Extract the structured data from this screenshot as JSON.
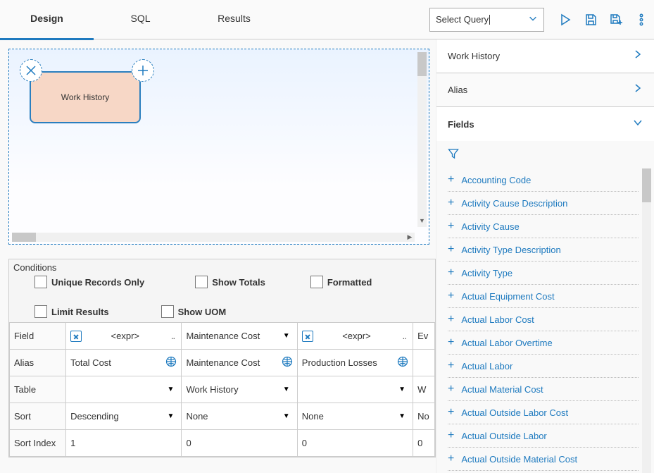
{
  "tabs": [
    "Design",
    "SQL",
    "Results"
  ],
  "activeTab": 0,
  "selectQuery": "Select Query",
  "canvasNode": {
    "label": "Work History"
  },
  "conditions": {
    "title": "Conditions",
    "unique": "Unique Records Only",
    "showTotals": "Show Totals",
    "formatted": "Formatted",
    "limitResults": "Limit Results",
    "showUom": "Show UOM"
  },
  "grid": {
    "rows": [
      "Field",
      "Alias",
      "Table",
      "Sort",
      "Sort Index"
    ],
    "cols": [
      {
        "field": "<expr>",
        "fieldExpr": true,
        "alias": "Total Cost",
        "table": "",
        "sort": "Descending",
        "sortIndex": "1"
      },
      {
        "field": "Maintenance Cost",
        "fieldExpr": false,
        "alias": "Maintenance Cost",
        "table": "Work History",
        "sort": "None",
        "sortIndex": "0"
      },
      {
        "field": "<expr>",
        "fieldExpr": true,
        "alias": "Production Losses",
        "table": "",
        "sort": "None",
        "sortIndex": "0"
      },
      {
        "field": "Ev",
        "fieldExpr": false,
        "alias": "",
        "table": "W",
        "sort": "No",
        "sortIndex": "0"
      }
    ]
  },
  "rightPanel": {
    "sec1": "Work History",
    "sec2": "Alias",
    "sec3": "Fields",
    "fields": [
      "Accounting Code",
      "Activity Cause Description",
      "Activity Cause",
      "Activity Type Description",
      "Activity Type",
      "Actual Equipment Cost",
      "Actual Labor Cost",
      "Actual Labor Overtime",
      "Actual Labor",
      "Actual Material Cost",
      "Actual Outside Labor Cost",
      "Actual Outside Labor",
      "Actual Outside Material Cost"
    ]
  }
}
